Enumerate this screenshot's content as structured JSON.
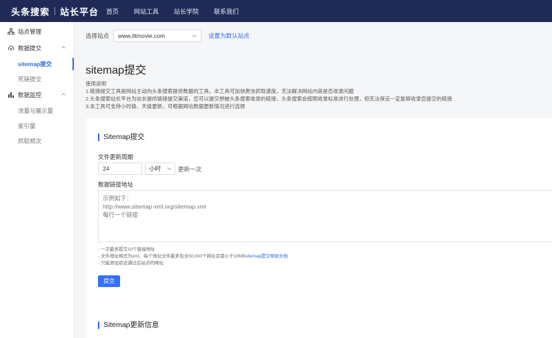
{
  "header": {
    "brand_main": "头条搜索",
    "brand_sub": "站长平台",
    "nav": [
      "首页",
      "网站工具",
      "站长学院",
      "联系我们"
    ]
  },
  "sidebar": {
    "site_manage": "站点管理",
    "data_submit": "数据提交",
    "submit_items": [
      "sitemap提交",
      "死链提交"
    ],
    "data_monitor": "数据监控",
    "monitor_items": [
      "流量与展示量",
      "索引量",
      "抓取频次"
    ]
  },
  "site": {
    "label": "选择站点",
    "selected": "www.ittmovie.com",
    "set_default": "设置为默认站点"
  },
  "page": {
    "title": "sitemap提交",
    "usage_title": "使用说明",
    "usage_lines": [
      "1.链接提交工具是网站主动向头条搜索提供数据的工具，本工具可加快爬虫抓取速度，无法解决网站内容是否收录问题",
      "2.头条搜索站长平台为站长提供链接提交渠道，您可以提交想被头条搜索收录的链接，头条搜索会按照收录标准进行处理，但无法保证一定能够收录您提交的链接",
      "3.本工具可支持小时级、天级更新，可根据网站数据更新情况进行选择"
    ]
  },
  "form": {
    "card_title": "Sitemap提交",
    "period_label": "文件更新周期",
    "period_value": "24",
    "unit_value": "小时",
    "unit_suffix": "更新一次",
    "url_label": "数据链接地址",
    "placeholder": "示例如下：\nhttp://www.sitemap-xml.org/sitemap.xml\n每行一个链接",
    "note1": "- 一次最多提交10个链接地址",
    "note2_pre": "- 文件地址格式为xml，每个地址文件最多包含50,000个网址且需小于10MB",
    "note2_link": "sitemap提交帮助文档",
    "note3": "- 只能添加验证通过后站点的网址",
    "submit": "提交"
  },
  "info_card": {
    "title": "Sitemap更新信息"
  },
  "colors": {
    "header_bg": "#1f2a57",
    "accent": "#2d6be4",
    "button": "#3370ff"
  }
}
